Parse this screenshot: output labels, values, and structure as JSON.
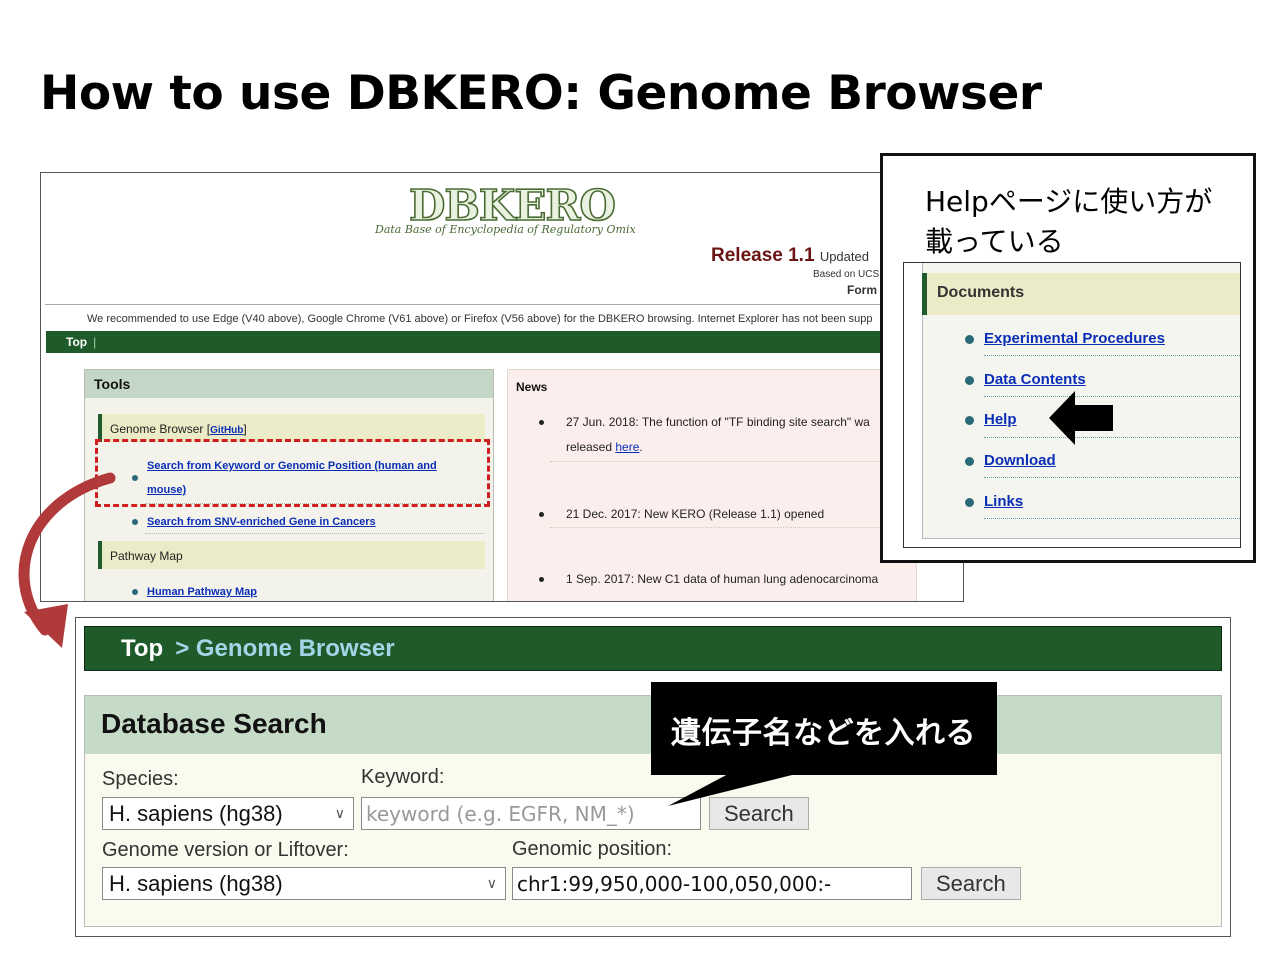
{
  "slide": {
    "title": "How to use DBKERO: Genome Browser"
  },
  "dbkero_home": {
    "logo_text": "DBKERO",
    "logo_tagline": "Data Base of Encyclopedia of Regulatory Omix",
    "release": "Release 1.1",
    "release_updated": "Updated",
    "based_on": "Based on UCS",
    "form_text": "Form",
    "browser_notice": "We recommended to use Edge (V40 above), Google Chrome (V61 above) or Firefox (V56 above) for the DBKERO browsing. Internet Explorer has not been supp",
    "nav": {
      "top": "Top",
      "separator": "|"
    },
    "tools": {
      "header": "Tools",
      "genome_browser": {
        "title": "Genome Browser",
        "github_prefix": "[",
        "github": "GitHub",
        "github_suffix": "]",
        "link_keyword_line1": "Search from Keyword or Genomic Position (human and",
        "link_keyword_line2": "mouse)",
        "link_snv": "Search from SNV-enriched Gene in Cancers"
      },
      "pathway_map": {
        "title": "Pathway Map",
        "link_human": "Human Pathway Map"
      }
    },
    "news": {
      "header": "News",
      "items": [
        {
          "line1": "27 Jun. 2018: The function of \"TF binding site search\" wa",
          "line2_prefix": "released ",
          "link": "here",
          "line2_suffix": "."
        },
        {
          "line1": "21 Dec. 2017: New KERO (Release 1.1) opened"
        },
        {
          "line1": "1 Sep. 2017: New C1 data of human lung adenocarcinoma"
        }
      ]
    }
  },
  "help_popup": {
    "caption_line1": "Helpページに使い方が",
    "caption_line2": "載っている",
    "documents": {
      "header": "Documents",
      "items": [
        "Experimental Procedures",
        "Data Contents",
        "Help",
        "Download",
        "Links"
      ]
    }
  },
  "genome_browser_page": {
    "breadcrumb_top": "Top",
    "breadcrumb_current": "> Genome Browser",
    "panel_title": "Database Search",
    "species_label": "Species:",
    "species_value": "H. sapiens (hg38)",
    "keyword_label": "Keyword:",
    "keyword_placeholder": "keyword (e.g. EGFR, NM_*)",
    "search_label": "Search",
    "genome_version_label": "Genome version or Liftover:",
    "genome_version_value": "H. sapiens (hg38)",
    "genomic_position_label": "Genomic position:",
    "genomic_position_value": "chr1:99,950,000-100,050,000:-",
    "search_label_2": "Search"
  },
  "callout": {
    "text": "遺伝子名などを入れる"
  },
  "colors": {
    "nav_green": "#1e5a2a",
    "link_blue": "#0b2eb6",
    "highlight_red": "#d01e1e",
    "arrow_red": "#b03a3a",
    "panel_green": "#c6dac8"
  },
  "icons": {
    "arrow_pointer": "left-arrow-icon",
    "curved_arrow": "curved-arrow-icon",
    "select_chevron": "chevron-down-icon"
  }
}
